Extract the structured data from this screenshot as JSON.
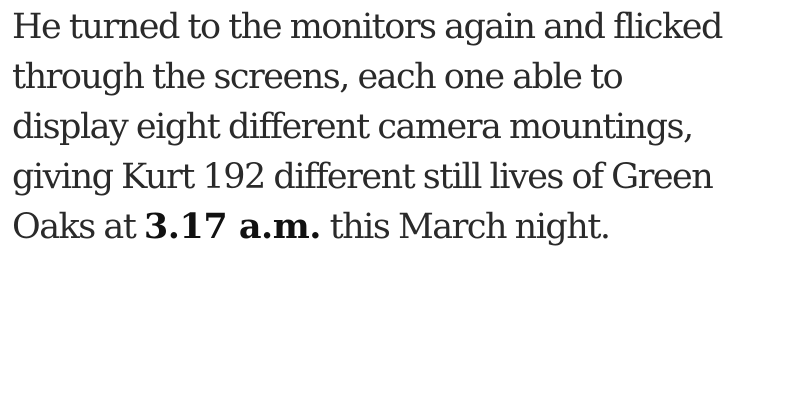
{
  "paragraph": {
    "lines": [
      "He turned to the monitors again and flicked",
      "through the screens, each one able to",
      "display eight different camera mountings,",
      "giving Kurt 192 different still lives of Green"
    ],
    "last_line": {
      "before": "Oaks at ",
      "emphasis": "3.17 a.m.",
      "after": " this March night."
    }
  },
  "colors": {
    "text": "#2a2a2a",
    "emphasis": "#111111",
    "background": "#ffffff"
  }
}
